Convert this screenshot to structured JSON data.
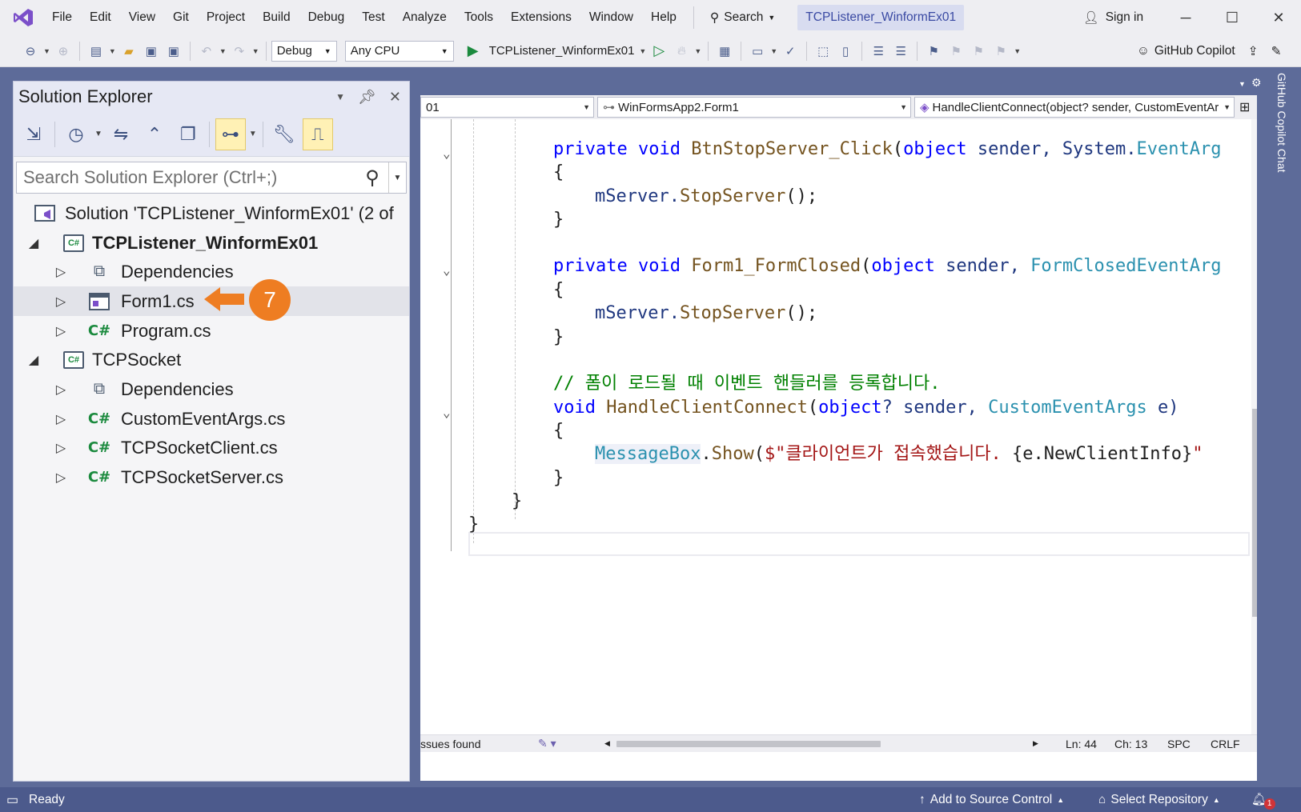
{
  "menubar": {
    "items": [
      "File",
      "Edit",
      "View",
      "Git",
      "Project",
      "Build",
      "Debug",
      "Test",
      "Analyze",
      "Tools",
      "Extensions",
      "Window",
      "Help"
    ],
    "search_label": "Search",
    "solution_title": "TCPListener_WinformEx01",
    "sign_in": "Sign in"
  },
  "toolbar": {
    "config": "Debug",
    "platform": "Any CPU",
    "run_target": "TCPListener_WinformEx01",
    "copilot": "GitHub Copilot"
  },
  "solution_explorer": {
    "title": "Solution Explorer",
    "search_placeholder": "Search Solution Explorer (Ctrl+;)",
    "nodes": [
      {
        "label": "Solution 'TCPListener_WinformEx01' (2 of",
        "icon": "solution-icon"
      },
      {
        "label": "TCPListener_WinformEx01",
        "icon": "csharp-project-icon"
      },
      {
        "label": "Dependencies",
        "icon": "dependencies-icon"
      },
      {
        "label": "Form1.cs",
        "icon": "form-icon"
      },
      {
        "label": "Program.cs",
        "icon": "csharp-file-icon"
      },
      {
        "label": "TCPSocket",
        "icon": "csharp-project-icon"
      },
      {
        "label": "Dependencies",
        "icon": "dependencies-icon"
      },
      {
        "label": "CustomEventArgs.cs",
        "icon": "csharp-file-icon"
      },
      {
        "label": "TCPSocketClient.cs",
        "icon": "csharp-file-icon"
      },
      {
        "label": "TCPSocketServer.cs",
        "icon": "csharp-file-icon"
      }
    ]
  },
  "annotation": {
    "step": "7",
    "color": "#ee7d22"
  },
  "editor": {
    "nav_project": "01",
    "nav_class": "WinFormsApp2.Form1",
    "nav_member": "HandleClientConnect(object? sender, CustomEventAr",
    "code": {
      "l1": {
        "kw1": "private",
        "kw2": "void",
        "mth": "BtnStopServer_Click",
        "p1": "(",
        "kw3": "object",
        "p2": " sender, System.",
        "ty": "EventArg"
      },
      "l2": "{",
      "l3": {
        "a": "mServer.",
        "mth": "StopServer",
        "b": "();"
      },
      "l4": "}",
      "l5": {
        "kw1": "private",
        "kw2": "void",
        "mth": "Form1_FormClosed",
        "p1": "(",
        "kw3": "object",
        "p2": " sender, ",
        "ty": "FormClosedEventArg"
      },
      "l6": "{",
      "l7": {
        "a": "mServer.",
        "mth": "StopServer",
        "b": "();"
      },
      "l8": "}",
      "l9": "// 폼이 로드될 때 이벤트 핸들러를 등록합니다.",
      "l10": {
        "kw1": "void",
        "mth": "HandleClientConnect",
        "p1": "(",
        "kw2": "object",
        "p2": "? sender, ",
        "ty": "CustomEventArgs",
        "p3": " e)"
      },
      "l11": "{",
      "l12": {
        "ty": "MessageBox",
        "a": ".",
        "mth": "Show",
        "b": "(",
        "str": "$\"클라이언트가 접속했습니다. ",
        "c": "{e.NewClientInfo}",
        "d": "\""
      },
      "l13": "}",
      "l14": "}",
      "l15": "}"
    },
    "issues": "ssues found",
    "ln": "Ln: 44",
    "ch": "Ch: 13",
    "spc": "SPC",
    "crlf": "CRLF"
  },
  "copilot_tab": "GitHub Copilot Chat",
  "statusbar": {
    "ready": "Ready",
    "source_control": "Add to Source Control",
    "repository": "Select Repository",
    "notifications": "1"
  }
}
